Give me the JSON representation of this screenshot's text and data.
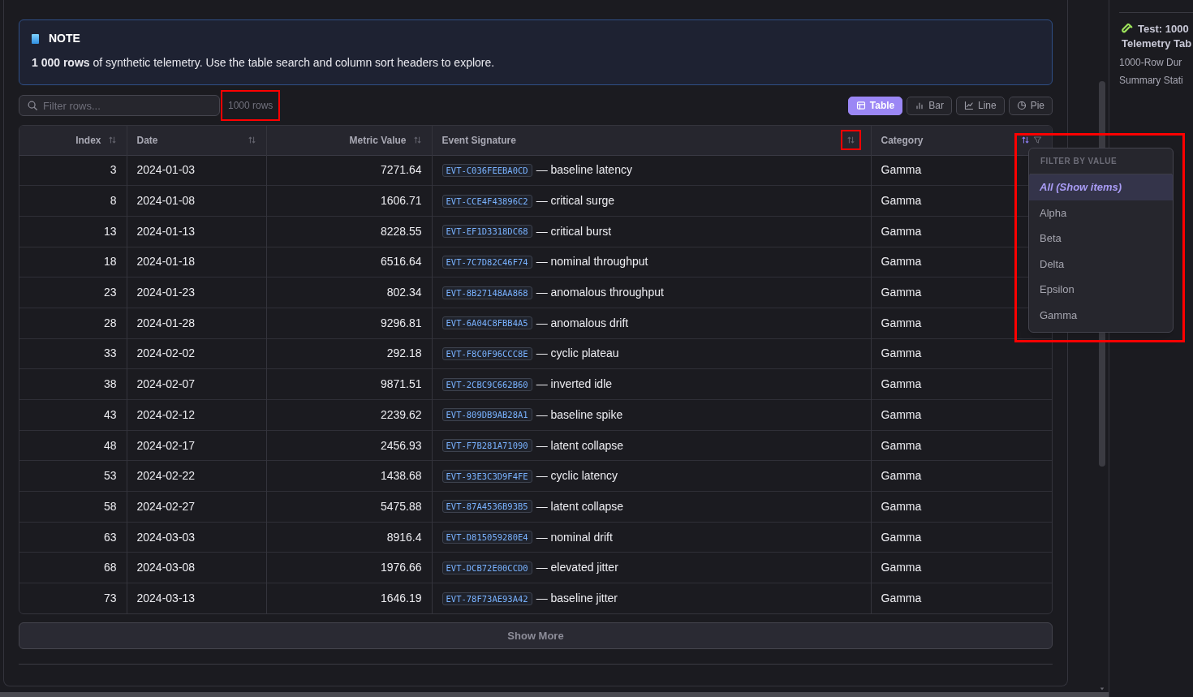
{
  "note": {
    "title": "NOTE",
    "text": "**1 000 rows** of synthetic telemetry. Use the table search and column sort headers to explore."
  },
  "toolbar": {
    "search": {
      "placeholder": "Filter rows..."
    },
    "row_count": {
      "text": "1000 rows",
      "highlighted": true
    },
    "views": [
      {
        "label": "Table",
        "selected": true
      },
      {
        "label": "Bar",
        "selected": false
      },
      {
        "label": "Line",
        "selected": false
      },
      {
        "label": "Pie",
        "selected": false
      }
    ]
  },
  "table": {
    "columns": [
      {
        "label": "Index",
        "sort_active": false,
        "sort_highlighted": false,
        "filter": false
      },
      {
        "label": "Date",
        "sort_active": false,
        "sort_highlighted": false,
        "filter": false
      },
      {
        "label": "Metric Value",
        "sort_active": false,
        "sort_highlighted": false,
        "filter": false
      },
      {
        "label": "Event Signature",
        "sort_active": false,
        "sort_highlighted": true,
        "filter": false
      },
      {
        "label": "Category",
        "sort_active": true,
        "sort_highlighted": false,
        "filter": true
      }
    ],
    "rows": [
      {
        "index": "3",
        "date": "2024-01-03",
        "value": "7271.64",
        "code": "EVT-C036FEEBA0CD",
        "event": "— baseline latency",
        "category": "Gamma"
      },
      {
        "index": "8",
        "date": "2024-01-08",
        "value": "1606.71",
        "code": "EVT-CCE4F43896C2",
        "event": "— critical surge",
        "category": "Gamma"
      },
      {
        "index": "13",
        "date": "2024-01-13",
        "value": "8228.55",
        "code": "EVT-EF1D3318DC68",
        "event": "— critical burst",
        "category": "Gamma"
      },
      {
        "index": "18",
        "date": "2024-01-18",
        "value": "6516.64",
        "code": "EVT-7C7D82C46F74",
        "event": "— nominal throughput",
        "category": "Gamma"
      },
      {
        "index": "23",
        "date": "2024-01-23",
        "value": "802.34",
        "code": "EVT-8B27148AA868",
        "event": "— anomalous throughput",
        "category": "Gamma"
      },
      {
        "index": "28",
        "date": "2024-01-28",
        "value": "9296.81",
        "code": "EVT-6A04C8FBB4A5",
        "event": "— anomalous drift",
        "category": "Gamma"
      },
      {
        "index": "33",
        "date": "2024-02-02",
        "value": "292.18",
        "code": "EVT-F8C0F96CCC8E",
        "event": "— cyclic plateau",
        "category": "Gamma"
      },
      {
        "index": "38",
        "date": "2024-02-07",
        "value": "9871.51",
        "code": "EVT-2CBC9C662B60",
        "event": "— inverted idle",
        "category": "Gamma"
      },
      {
        "index": "43",
        "date": "2024-02-12",
        "value": "2239.62",
        "code": "EVT-809DB9AB28A1",
        "event": "— baseline spike",
        "category": "Gamma"
      },
      {
        "index": "48",
        "date": "2024-02-17",
        "value": "2456.93",
        "code": "EVT-F7B281A71090",
        "event": "— latent collapse",
        "category": "Gamma"
      },
      {
        "index": "53",
        "date": "2024-02-22",
        "value": "1438.68",
        "code": "EVT-93E3C3D9F4FE",
        "event": "— cyclic latency",
        "category": "Gamma"
      },
      {
        "index": "58",
        "date": "2024-02-27",
        "value": "5475.88",
        "code": "EVT-87A4536B93B5",
        "event": "— latent collapse",
        "category": "Gamma"
      },
      {
        "index": "63",
        "date": "2024-03-03",
        "value": "8916.4",
        "code": "EVT-D815059280E4",
        "event": "— nominal drift",
        "category": "Gamma"
      },
      {
        "index": "68",
        "date": "2024-03-08",
        "value": "1976.66",
        "code": "EVT-DCB72E00CCD0",
        "event": "— elevated jitter",
        "category": "Gamma"
      },
      {
        "index": "73",
        "date": "2024-03-13",
        "value": "1646.19",
        "code": "EVT-78F73AE93A42",
        "event": "— baseline jitter",
        "category": "Gamma"
      }
    ]
  },
  "filter_menu": {
    "title": "FILTER BY VALUE",
    "highlighted": true,
    "options": [
      {
        "label": "All (Show items)",
        "selected": true
      },
      {
        "label": "Alpha",
        "selected": false
      },
      {
        "label": "Beta",
        "selected": false
      },
      {
        "label": "Delta",
        "selected": false
      },
      {
        "label": "Epsilon",
        "selected": false
      },
      {
        "label": "Gamma",
        "selected": false
      }
    ]
  },
  "show_more": "Show More",
  "sidebar": {
    "heading_lines": [
      "Test: 1000",
      "Telemetry Tab"
    ],
    "links": [
      "1000-Row Dur",
      "Summary Stati"
    ]
  }
}
